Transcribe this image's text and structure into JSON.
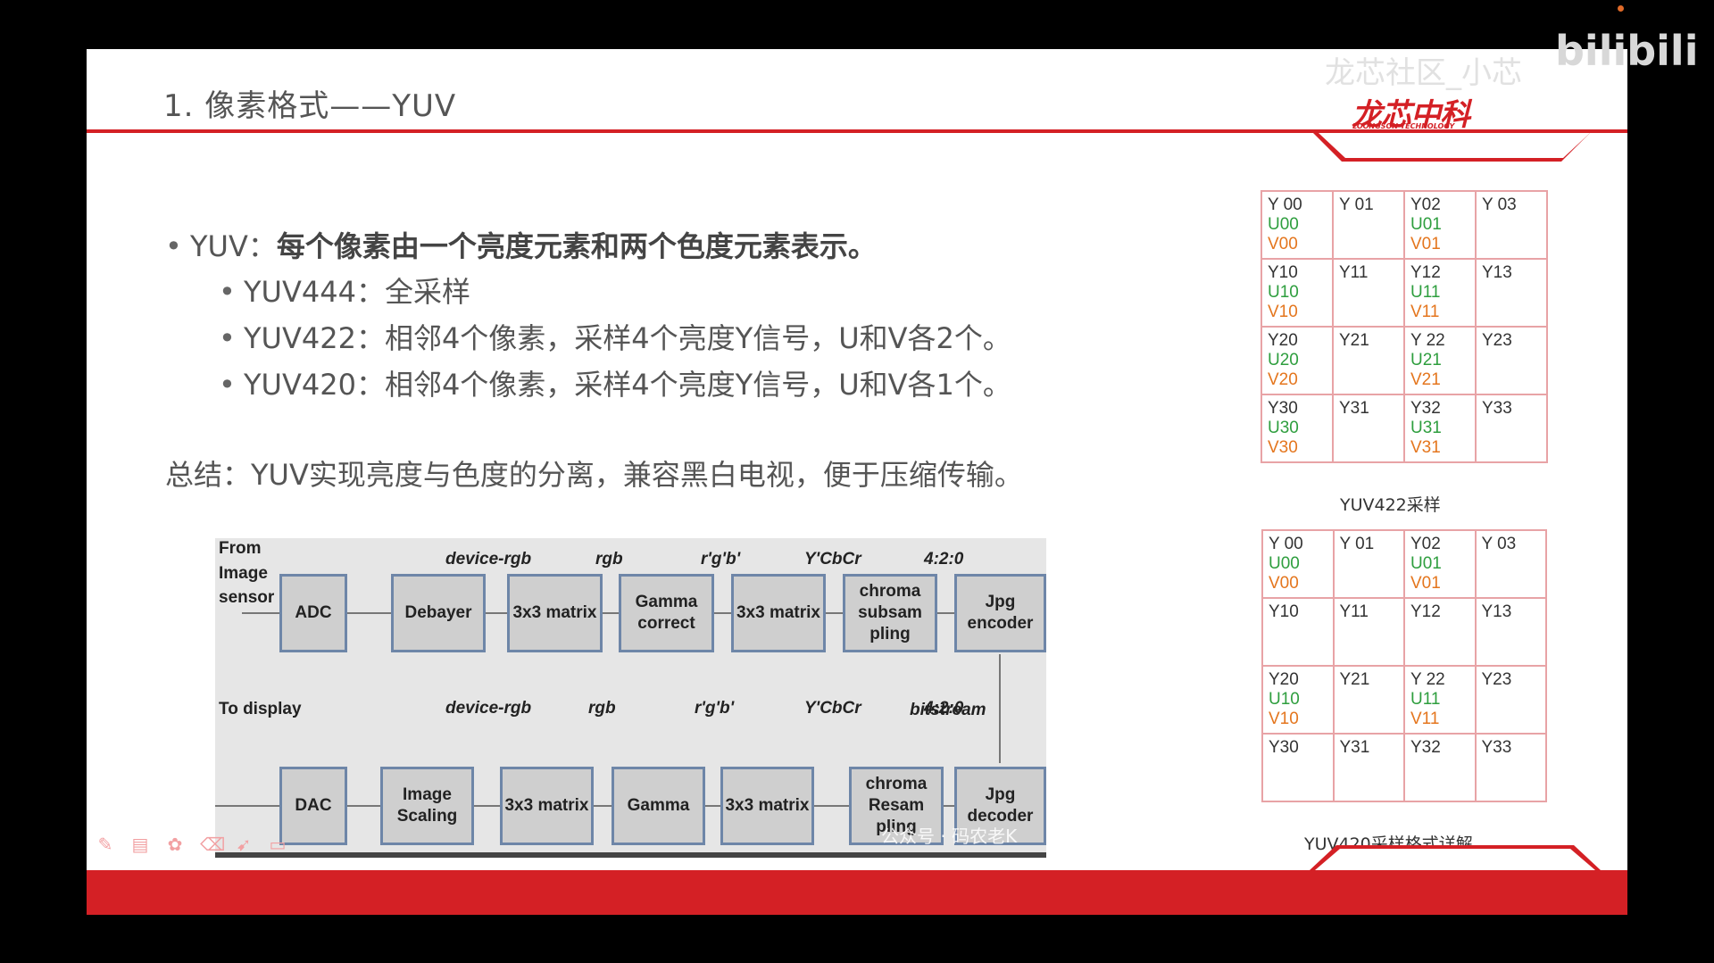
{
  "slide": {
    "title": "1.    像素格式——YUV",
    "logo_text": "龙芯中科",
    "logo_sub": "LOONGSON TECHNOLOGY",
    "bullet_main_prefix": "YUV：",
    "bullet_main_bold": "每个像素由一个亮度元素和两个色度元素表示。",
    "sub_bullets": [
      "YUV444：全采样",
      "YUV422：相邻4个像素，采样4个亮度Y信号，U和V各2个。",
      "YUV420：相邻4个像素，采样4个亮度Y信号，U和V各1个。"
    ],
    "summary": "总结：YUV实现亮度与色度的分离，兼容黑白电视，便于压缩传输。"
  },
  "diagram": {
    "top_labels": [
      "device-rgb",
      "rgb",
      "r'g'b'",
      "Y'CbCr",
      "4:2:0"
    ],
    "bottom_labels": [
      "device-rgb",
      "rgb",
      "r'g'b'",
      "Y'CbCr",
      "4:2:0"
    ],
    "from_line1": "From",
    "from_line2": "Image",
    "from_line3": "sensor",
    "to_display": "To display",
    "bitstream": "bitstream",
    "top_blocks": [
      "ADC",
      "Debayer",
      "3x3 matrix",
      "Gamma correct",
      "3x3 matrix",
      "chroma subsam pling",
      "Jpg encoder"
    ],
    "bottom_blocks": [
      "DAC",
      "Image Scaling",
      "3x3 matrix",
      "Gamma",
      "3x3 matrix",
      "chroma Resam pling",
      "Jpg decoder"
    ],
    "watermark": "公众号 · 码农老K"
  },
  "yuv422": {
    "caption": "YUV422采样",
    "cells": [
      [
        [
          "Y 00",
          "U00",
          "V00"
        ],
        [
          "Y 01"
        ],
        [
          "Y02",
          "U01",
          "V01"
        ],
        [
          "Y 03"
        ]
      ],
      [
        [
          "Y10",
          "U10",
          "V10"
        ],
        [
          "Y11"
        ],
        [
          "Y12",
          "U11",
          "V11"
        ],
        [
          "Y13"
        ]
      ],
      [
        [
          "Y20",
          "U20",
          "V20"
        ],
        [
          "Y21"
        ],
        [
          "Y 22",
          "U21",
          "V21"
        ],
        [
          "Y23"
        ]
      ],
      [
        [
          "Y30",
          "U30",
          "V30"
        ],
        [
          "Y31"
        ],
        [
          "Y32",
          "U31",
          "V31"
        ],
        [
          "Y33"
        ]
      ]
    ]
  },
  "yuv420": {
    "caption": "YUV420采样格式详解",
    "cells": [
      [
        [
          "Y 00",
          "U00",
          "V00"
        ],
        [
          "Y 01"
        ],
        [
          "Y02",
          "U01",
          "V01"
        ],
        [
          "Y 03"
        ]
      ],
      [
        [
          "Y10"
        ],
        [
          "Y11"
        ],
        [
          "Y12"
        ],
        [
          "Y13"
        ]
      ],
      [
        [
          "Y20",
          "U10",
          "V10"
        ],
        [
          "Y21"
        ],
        [
          "Y 22",
          "U11",
          "V11"
        ],
        [
          "Y23"
        ]
      ],
      [
        [
          "Y30"
        ],
        [
          "Y31"
        ],
        [
          "Y32"
        ],
        [
          "Y33"
        ]
      ]
    ]
  },
  "overlay": {
    "channel": "龙芯社区_小芯",
    "bili": "bilibili"
  },
  "colors": {
    "accent": "#d42025",
    "u_color": "#2e9e3e",
    "v_color": "#e4761e"
  },
  "toolbar_icons": [
    "pen-icon",
    "save-icon",
    "palette-icon",
    "eraser-icon",
    "pointer-icon",
    "screen-icon"
  ]
}
